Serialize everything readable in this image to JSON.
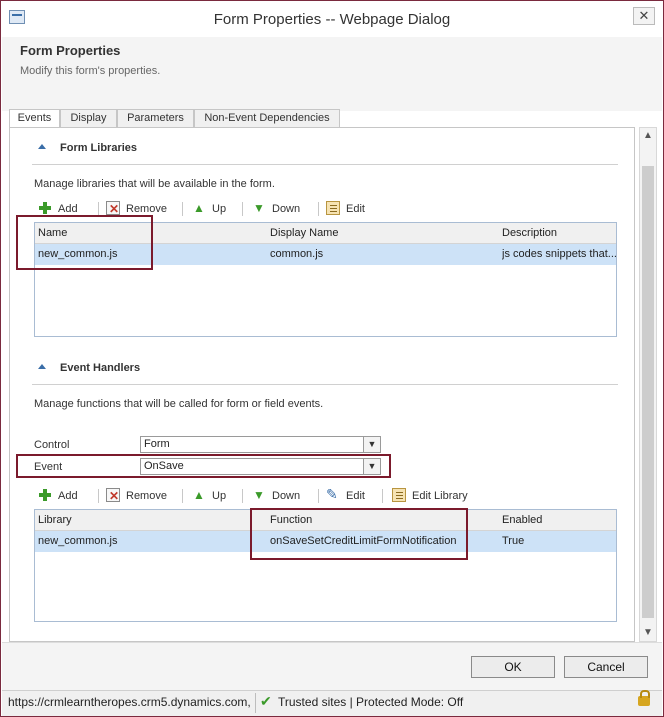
{
  "window": {
    "title": "Form Properties -- Webpage Dialog",
    "close_symbol": "✕"
  },
  "header": {
    "title": "Form Properties",
    "subtitle": "Modify this form's properties."
  },
  "tabs": [
    {
      "label": "Events",
      "active": true
    },
    {
      "label": "Display",
      "active": false
    },
    {
      "label": "Parameters",
      "active": false
    },
    {
      "label": "Non-Event Dependencies",
      "active": false
    }
  ],
  "form_libraries": {
    "title": "Form Libraries",
    "description": "Manage libraries that will be available in the form.",
    "toolbar": {
      "add": "Add",
      "remove": "Remove",
      "up": "Up",
      "down": "Down",
      "edit": "Edit"
    },
    "columns": [
      "Name",
      "Display Name",
      "Description"
    ],
    "rows": [
      {
        "name": "new_common.js",
        "display_name": "common.js",
        "description": "js codes snippets that..."
      }
    ]
  },
  "event_handlers": {
    "title": "Event Handlers",
    "description": "Manage functions that will be called for form or field events.",
    "control_label": "Control",
    "control_value": "Form",
    "event_label": "Event",
    "event_value": "OnSave",
    "toolbar": {
      "add": "Add",
      "remove": "Remove",
      "up": "Up",
      "down": "Down",
      "edit": "Edit",
      "edit_library": "Edit Library"
    },
    "columns": [
      "Library",
      "Function",
      "Enabled"
    ],
    "rows": [
      {
        "library": "new_common.js",
        "function": "onSaveSetCreditLimitFormNotification",
        "enabled": "True"
      }
    ]
  },
  "footer": {
    "ok": "OK",
    "cancel": "Cancel"
  },
  "statusbar": {
    "url": "https://crmlearntheropes.crm5.dynamics.com,",
    "zone": "Trusted sites | Protected Mode: Off"
  },
  "colors": {
    "highlight": "#7b1a2c",
    "selected_row": "#cde2f7",
    "accent": "#3a6ea8"
  }
}
